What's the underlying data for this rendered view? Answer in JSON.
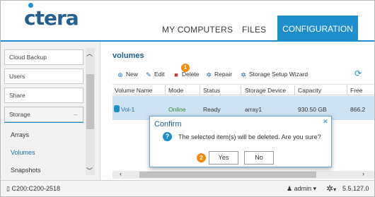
{
  "header": {
    "logo": "ctera",
    "nav": [
      "MY COMPUTERS",
      "FILES",
      "CONFIGURATION"
    ]
  },
  "sidebar": {
    "groups": [
      "Cloud Backup",
      "Users",
      "Share",
      "Storage"
    ],
    "collapse_glyph": "–",
    "sub_items": [
      "Arrays",
      "Volumes",
      "Snapshots"
    ]
  },
  "main": {
    "title": "volumes",
    "toolbar": {
      "new": "New",
      "edit": "Edit",
      "delete": "Delete",
      "repair": "Repair",
      "storage_setup": "Storage Setup Wizard"
    },
    "delete_step": "1",
    "columns": [
      "Volume Name",
      "Mode",
      "Status",
      "Storage Device",
      "Capacity",
      "Free"
    ],
    "rows": [
      [
        "Vol-1",
        "Online",
        "Ready",
        "array1",
        "930.50 GB",
        "866.2"
      ]
    ]
  },
  "status_bar": {
    "device": "C200:C200-2518",
    "user": "admin",
    "version": "5.5.127.0"
  },
  "dialog": {
    "title": "Confirm",
    "message": "The selected item(s) will be deleted. Are you sure?",
    "step": "2",
    "yes": "Yes",
    "no": "No"
  },
  "colors": {
    "accent": "#1f8fcb",
    "badge": "#f28b10",
    "selected_row": "#cfe2f2",
    "online": "#2a8a2a"
  }
}
